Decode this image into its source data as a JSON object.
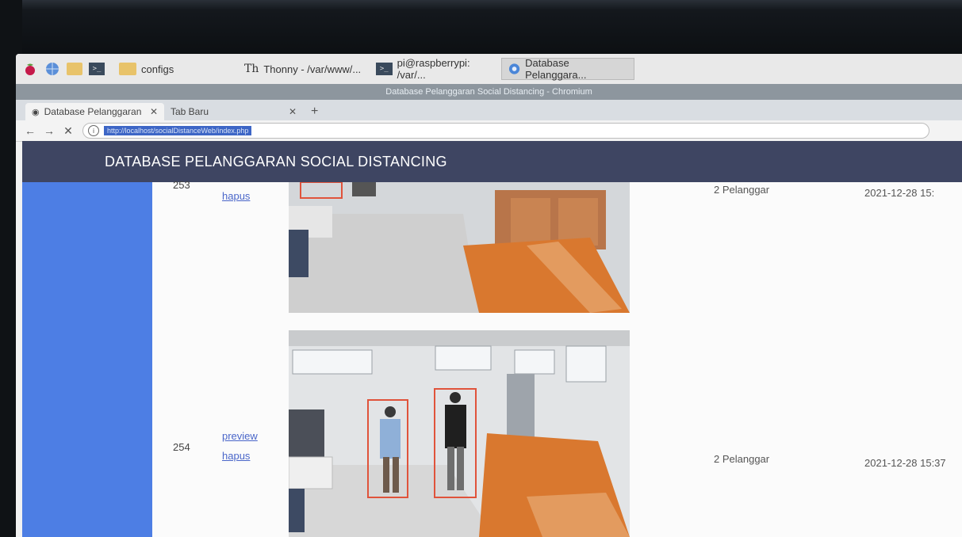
{
  "taskbar": {
    "items": [
      {
        "label": "configs"
      },
      {
        "label": "Thonny - /var/www/..."
      },
      {
        "label": "pi@raspberrypi: /var/..."
      },
      {
        "label": "Database Pelanggara..."
      }
    ]
  },
  "window": {
    "title": "Database Pelanggaran Social Distancing - Chromium"
  },
  "tabs": [
    {
      "label": "Database Pelanggaran"
    },
    {
      "label": "Tab Baru"
    }
  ],
  "addressbar": {
    "url": "http://localhost/socialDistanceWeb/index.php"
  },
  "page": {
    "title": "DATABASE PELANGGARAN SOCIAL DISTANCING"
  },
  "records": [
    {
      "id": "253",
      "actions": [
        "hapus"
      ],
      "pelanggar": "2 Pelanggar",
      "waktu": "2021-12-28 15:"
    },
    {
      "id": "254",
      "actions": [
        "preview",
        "hapus"
      ],
      "pelanggar": "2 Pelanggar",
      "waktu": "2021-12-28 15:37"
    }
  ],
  "colors": {
    "header": "#3e4562",
    "sidebar": "#4d7ee4",
    "link": "#4a66c9",
    "detection_box": "#e0533b"
  }
}
